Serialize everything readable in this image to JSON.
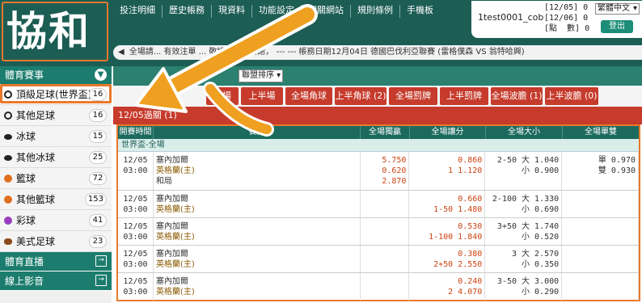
{
  "logo": "協和",
  "nav": [
    "投注明細",
    "歷史帳務",
    "現資料",
    "功能設定",
    "相關網站",
    "規則條例",
    "手機板"
  ],
  "account": {
    "username": "1test0001_cob",
    "dates": "[12/05] 0\n[12/06] 0\n[點  數] 0",
    "language": "繁體中文",
    "logout": "登出"
  },
  "ticker": "全場請... 有效注單 ... 敬請注意，謝謝， ---   --- 帳務日期12月04日 德國巴伐利亞聯賽 (雷格僕森 VS 翁特哈興)",
  "sidebar": {
    "title": "體育賽事",
    "items": [
      {
        "label": "頂級足球(世界盃)",
        "count": "16",
        "icon": "soccer-icon",
        "active": true
      },
      {
        "label": "其他足球",
        "count": "16",
        "icon": "soccer-icon"
      },
      {
        "label": "冰球",
        "count": "15",
        "icon": "hockey-puck-icon"
      },
      {
        "label": "其他冰球",
        "count": "25",
        "icon": "hockey-puck-icon"
      },
      {
        "label": "籃球",
        "count": "72",
        "icon": "basketball-icon"
      },
      {
        "label": "其他籃球",
        "count": "153",
        "icon": "basketball-icon"
      },
      {
        "label": "彩球",
        "count": "41",
        "icon": "lottery-ball-icon"
      },
      {
        "label": "美式足球",
        "count": "23",
        "icon": "american-football-icon"
      }
    ],
    "links": [
      {
        "label": "體育直播",
        "icon": "enter-icon"
      },
      {
        "label": "線上影音",
        "icon": "enter-icon"
      }
    ]
  },
  "filter": {
    "sort": "聯盟排序"
  },
  "tabs": [
    "全場 (3)",
    "上半場 (3)",
    "全場角球 (2)",
    "上半角球 (2)",
    "全場罰牌 (1)",
    "上半罰牌 (1)",
    "全場波膽 (1)",
    "上半波膽 (0)"
  ],
  "date_bar": "12/05過關 (1)",
  "table": {
    "headers": [
      "開賽時間",
      "賽隊",
      "全場獨贏",
      "全場讓分",
      "全場大小",
      "全場單雙"
    ],
    "league": "世界盃-全場",
    "rows": [
      {
        "date": "12/05",
        "time": "03:00",
        "home": "塞內加爾",
        "away": "英格蘭(主)",
        "draw": "和局",
        "ml": [
          "5.750",
          "0.620",
          "2.870"
        ],
        "hdp": [
          "0.860",
          "1 1.120"
        ],
        "ou": [
          "2-50 大 1.040",
          "小 0.900"
        ],
        "oe": [
          "單 0.970",
          "雙 0.930"
        ]
      },
      {
        "date": "12/05",
        "time": "03:00",
        "home": "塞內加爾",
        "away": "英格蘭(主)",
        "draw": "",
        "ml": [
          "",
          "",
          ""
        ],
        "hdp": [
          "0.660",
          "1-50 1.480"
        ],
        "ou": [
          "2-100 大 1.330",
          "小 0.690"
        ],
        "oe": [
          "",
          ""
        ]
      },
      {
        "date": "12/05",
        "time": "03:00",
        "home": "塞內加爾",
        "away": "英格蘭(主)",
        "draw": "",
        "ml": [
          "",
          "",
          ""
        ],
        "hdp": [
          "0.530",
          "1-100 1.840"
        ],
        "ou": [
          "3+50 大 1.740",
          "小 0.520"
        ],
        "oe": [
          "",
          ""
        ]
      },
      {
        "date": "12/05",
        "time": "03:00",
        "home": "塞內加爾",
        "away": "英格蘭(主)",
        "draw": "",
        "ml": [
          "",
          "",
          ""
        ],
        "hdp": [
          "0.380",
          "2+50 2.550"
        ],
        "ou": [
          "3 大 2.570",
          "小 0.350"
        ],
        "oe": [
          "",
          ""
        ]
      },
      {
        "date": "12/05",
        "time": "03:00",
        "home": "塞內加爾",
        "away": "英格蘭(主)",
        "draw": "",
        "ml": [
          "",
          "",
          ""
        ],
        "hdp": [
          "0.240",
          "2 4.070"
        ],
        "ou": [
          "3-50 大 3.000",
          "小 0.290"
        ],
        "oe": [
          "",
          ""
        ]
      }
    ]
  },
  "colors": {
    "header": "#1c5d54",
    "accent": "#c63b2c",
    "highlight": "#e8792b"
  }
}
